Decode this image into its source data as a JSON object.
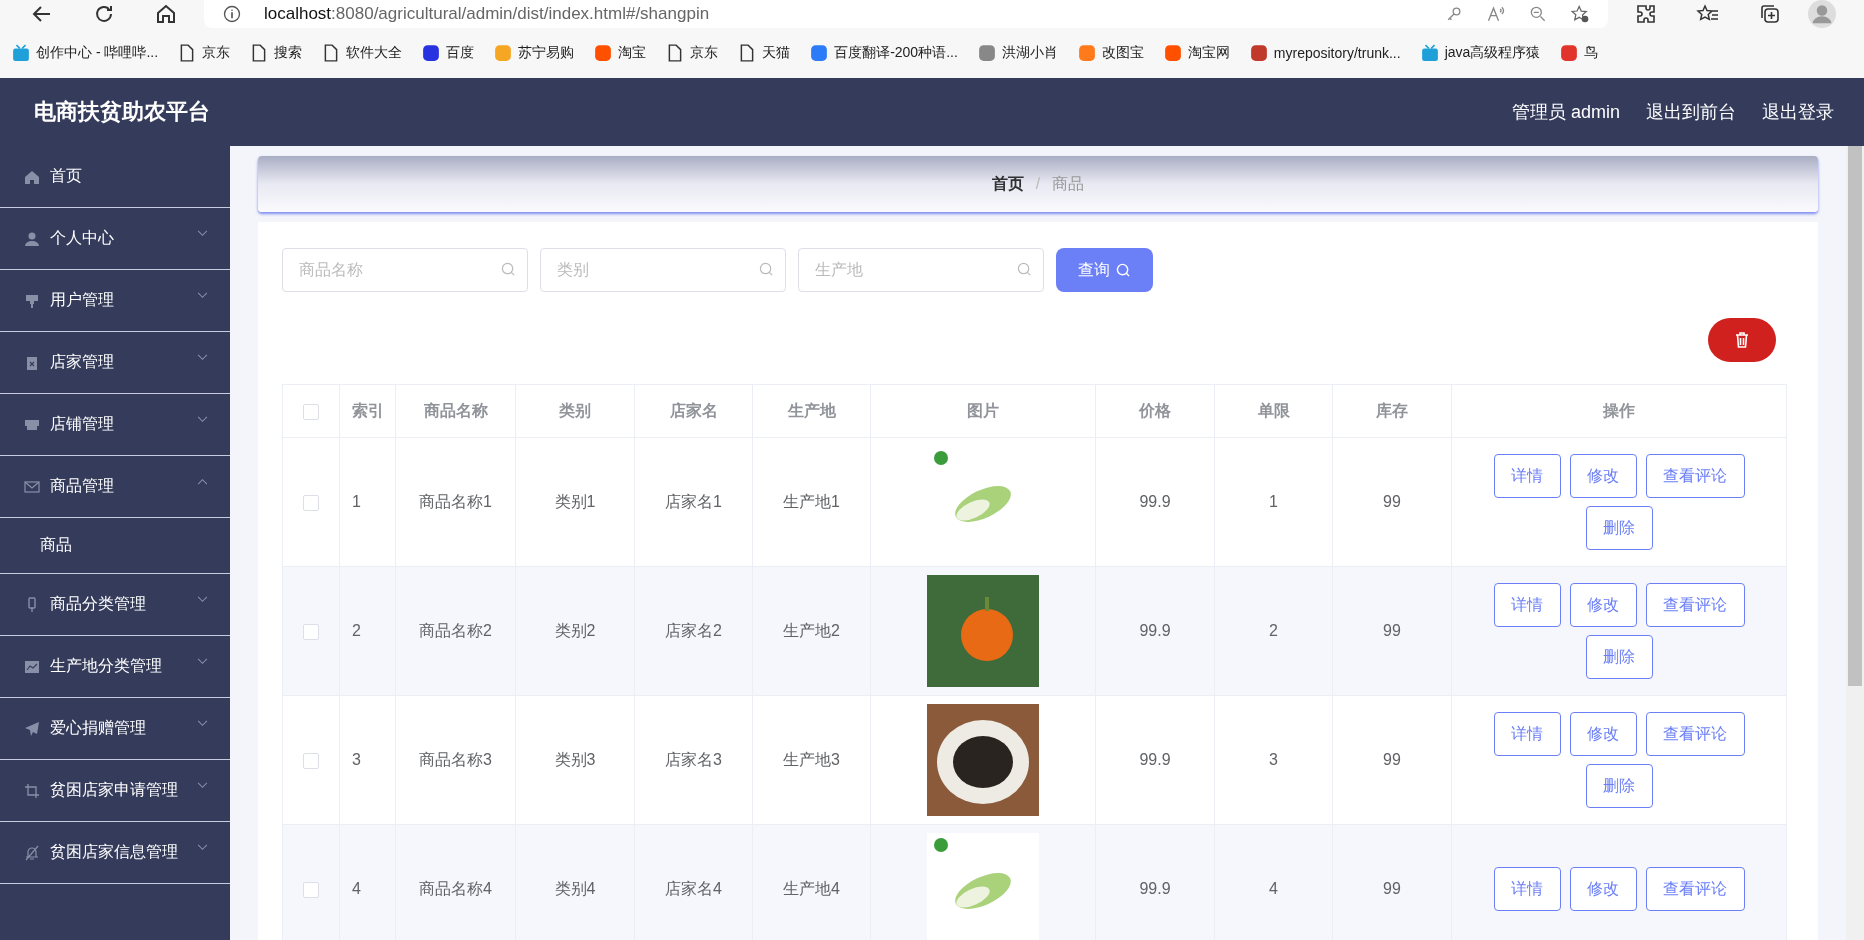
{
  "browser": {
    "url_host": "localhost",
    "url_path": ":8080/agricultural/admin/dist/index.html#/shangpin",
    "bookmarks": [
      {
        "label": "创作中心 - 哔哩哔...",
        "kind": "tv"
      },
      {
        "label": "京东",
        "kind": "page"
      },
      {
        "label": "搜索",
        "kind": "page"
      },
      {
        "label": "软件大全",
        "kind": "page"
      },
      {
        "label": "百度",
        "kind": "paw"
      },
      {
        "label": "苏宁易购",
        "kind": "sun"
      },
      {
        "label": "淘宝",
        "kind": "tao"
      },
      {
        "label": "京东",
        "kind": "page"
      },
      {
        "label": "天猫",
        "kind": "page"
      },
      {
        "label": "百度翻译-200种语...",
        "kind": "translate"
      },
      {
        "label": "洪湖小肖",
        "kind": "bird"
      },
      {
        "label": "改图宝",
        "kind": "square"
      },
      {
        "label": "淘宝网",
        "kind": "tao2"
      },
      {
        "label": "myrepository/trunk...",
        "kind": "globe"
      },
      {
        "label": "java高级程序猿",
        "kind": "tv"
      },
      {
        "label": "鸟",
        "kind": "bird2"
      }
    ]
  },
  "header": {
    "title": "电商扶贫助农平台",
    "user": "管理员 admin",
    "links": [
      "退出到前台",
      "退出登录"
    ]
  },
  "sidebar": {
    "items": [
      {
        "label": "首页",
        "kind": "link"
      },
      {
        "label": "个人中心",
        "kind": "menu",
        "expanded": false
      },
      {
        "label": "用户管理",
        "kind": "menu",
        "expanded": false
      },
      {
        "label": "店家管理",
        "kind": "menu",
        "expanded": false
      },
      {
        "label": "店铺管理",
        "kind": "menu",
        "expanded": false
      },
      {
        "label": "商品管理",
        "kind": "menu",
        "expanded": true,
        "children": [
          {
            "label": "商品"
          }
        ]
      },
      {
        "label": "商品分类管理",
        "kind": "menu",
        "expanded": false
      },
      {
        "label": "生产地分类管理",
        "kind": "menu",
        "expanded": false
      },
      {
        "label": "爱心捐赠管理",
        "kind": "menu",
        "expanded": false
      },
      {
        "label": "贫困店家申请管理",
        "kind": "menu",
        "expanded": false
      },
      {
        "label": "贫困店家信息管理",
        "kind": "menu",
        "expanded": false
      }
    ]
  },
  "breadcrumb": {
    "items": [
      "首页",
      "商品"
    ],
    "separator": "/"
  },
  "search": {
    "fields": [
      {
        "placeholder": "商品名称"
      },
      {
        "placeholder": "类别"
      },
      {
        "placeholder": "生产地"
      }
    ],
    "button": "查询"
  },
  "table": {
    "header_checked": false,
    "columns": [
      "索引",
      "商品名称",
      "类别",
      "店家名",
      "生产地",
      "图片",
      "价格",
      "单限",
      "库存",
      "操作"
    ],
    "rows": [
      {
        "checked": false,
        "cells": [
          "1",
          "商品名称1",
          "类别1",
          "店家名1",
          "生产地1"
        ],
        "tail": [
          "99.9",
          "1",
          "99"
        ],
        "actions": [
          "详情",
          "修改",
          "查看评论",
          "删除"
        ]
      },
      {
        "checked": false,
        "cells": [
          "2",
          "商品名称2",
          "类别2",
          "店家名2",
          "生产地2"
        ],
        "tail": [
          "99.9",
          "2",
          "99"
        ],
        "actions": [
          "详情",
          "修改",
          "查看评论",
          "删除"
        ]
      },
      {
        "checked": false,
        "cells": [
          "3",
          "商品名称3",
          "类别3",
          "店家名3",
          "生产地3"
        ],
        "tail": [
          "99.9",
          "3",
          "99"
        ],
        "actions": [
          "详情",
          "修改",
          "查看评论",
          "删除"
        ]
      },
      {
        "checked": false,
        "cells": [
          "4",
          "商品名称4",
          "类别4",
          "店家名4",
          "生产地4"
        ],
        "tail": [
          "99.9",
          "4",
          "99"
        ],
        "actions": [
          "详情",
          "修改",
          "查看评论"
        ]
      }
    ]
  }
}
